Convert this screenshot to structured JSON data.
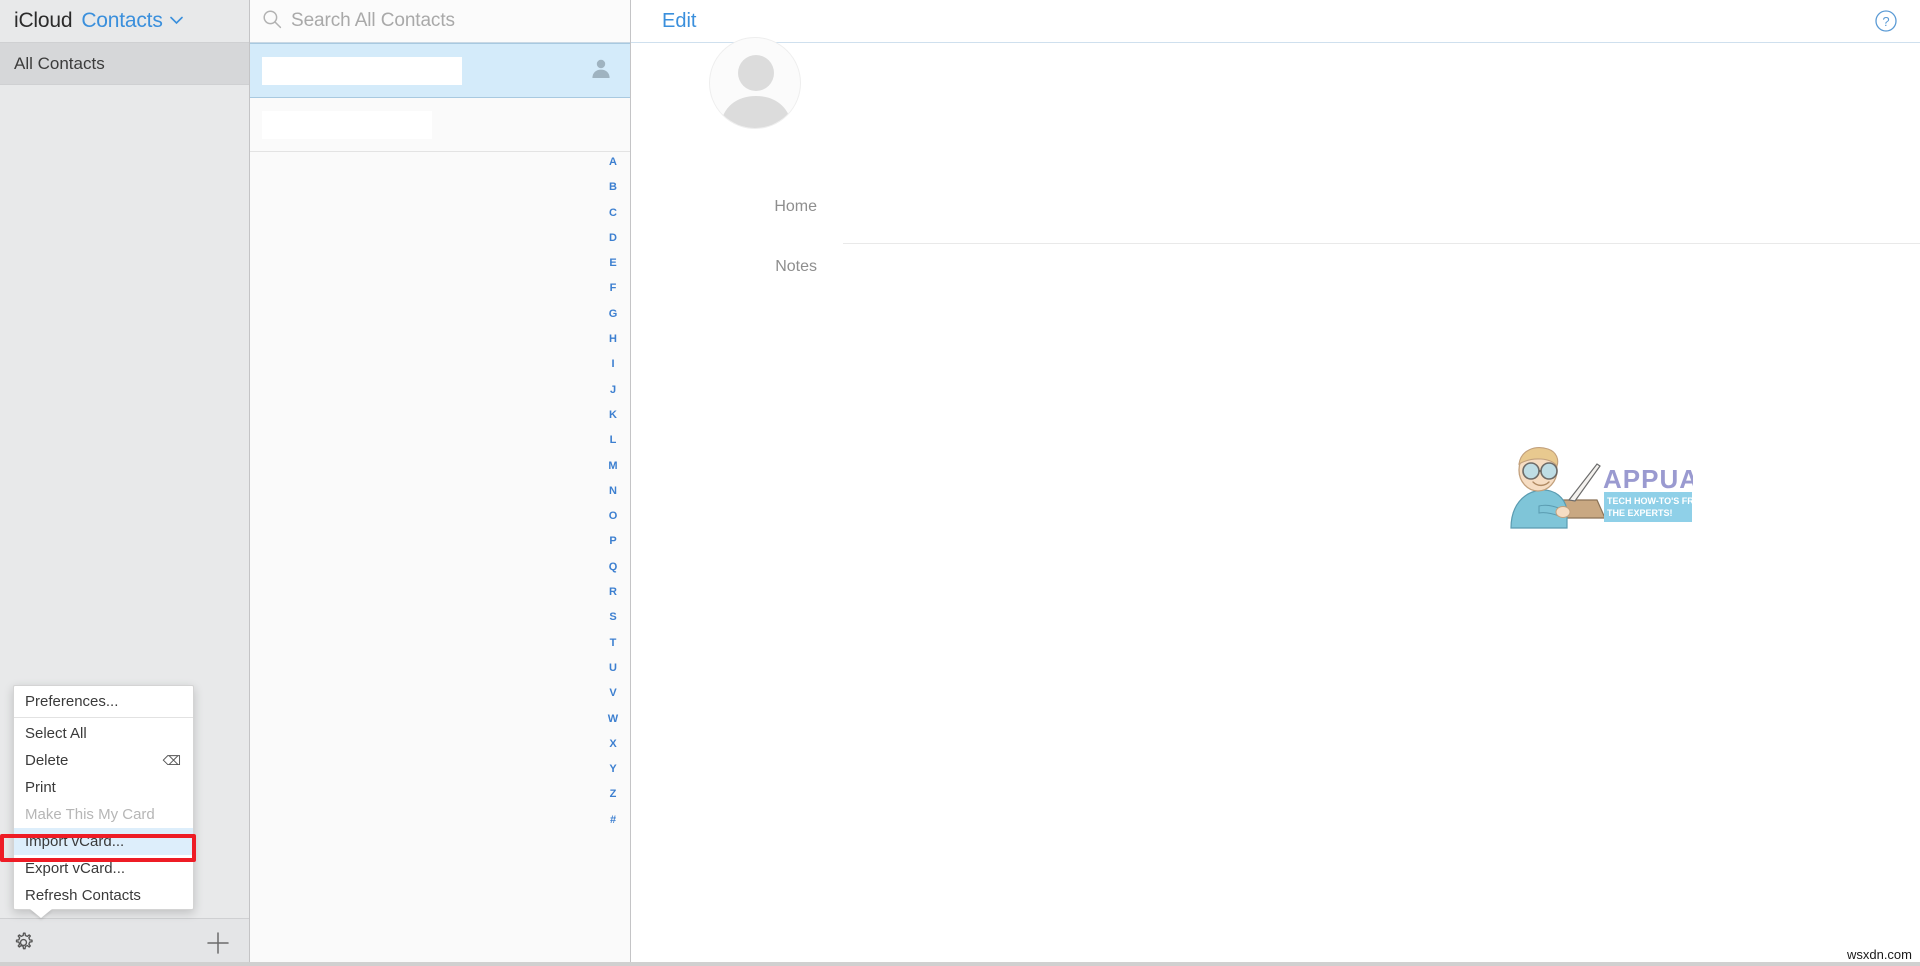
{
  "app": {
    "brand": "iCloud",
    "section": "Contacts",
    "chevron_icon": "chevron-down-icon",
    "watermark": "wsxdn.com"
  },
  "sidebar": {
    "groups": [
      {
        "label": "All Contacts",
        "selected": true
      }
    ],
    "footer": {
      "settings_icon": "gear-icon",
      "add_icon": "plus-icon"
    }
  },
  "context_menu": {
    "visible": true,
    "highlight_color": "#ee1c25",
    "items": [
      {
        "label": "Preferences...",
        "disabled": false,
        "highlighted": false,
        "shortcut": ""
      },
      {
        "label": "Select All",
        "disabled": false,
        "highlighted": false,
        "shortcut": ""
      },
      {
        "label": "Delete",
        "disabled": false,
        "highlighted": false,
        "shortcut": "⌫"
      },
      {
        "label": "Print",
        "disabled": false,
        "highlighted": false,
        "shortcut": ""
      },
      {
        "label": "Make This My Card",
        "disabled": true,
        "highlighted": false,
        "shortcut": ""
      },
      {
        "label": "Import vCard...",
        "disabled": false,
        "highlighted": true,
        "shortcut": ""
      },
      {
        "label": "Export vCard...",
        "disabled": false,
        "highlighted": false,
        "shortcut": ""
      },
      {
        "label": "Refresh Contacts",
        "disabled": false,
        "highlighted": false,
        "shortcut": ""
      }
    ]
  },
  "search": {
    "icon": "search-icon",
    "placeholder": "Search All Contacts",
    "value": ""
  },
  "contact_list": {
    "rows": [
      {
        "name": "",
        "redacted": true,
        "selected": true,
        "has_avatar_icon": true
      },
      {
        "name": "",
        "redacted": true,
        "selected": false,
        "has_avatar_icon": false
      }
    ],
    "alphabet_index": [
      "A",
      "B",
      "C",
      "D",
      "E",
      "F",
      "G",
      "H",
      "I",
      "J",
      "K",
      "L",
      "M",
      "N",
      "O",
      "P",
      "Q",
      "R",
      "S",
      "T",
      "U",
      "V",
      "W",
      "X",
      "Y",
      "Z",
      "#"
    ]
  },
  "detail": {
    "edit_label": "Edit",
    "help_icon": "question-mark-circle-icon",
    "avatar_icon": "person-placeholder-icon",
    "fields": [
      {
        "label": "Home",
        "value": ""
      },
      {
        "label": "Notes",
        "value": ""
      }
    ]
  },
  "logo": {
    "name": "APPUALS",
    "tagline_line1": "TECH HOW-TO'S FROM",
    "tagline_line2": "THE EXPERTS!",
    "accent": "#8f8fc6",
    "band": "#8fd0e8"
  }
}
